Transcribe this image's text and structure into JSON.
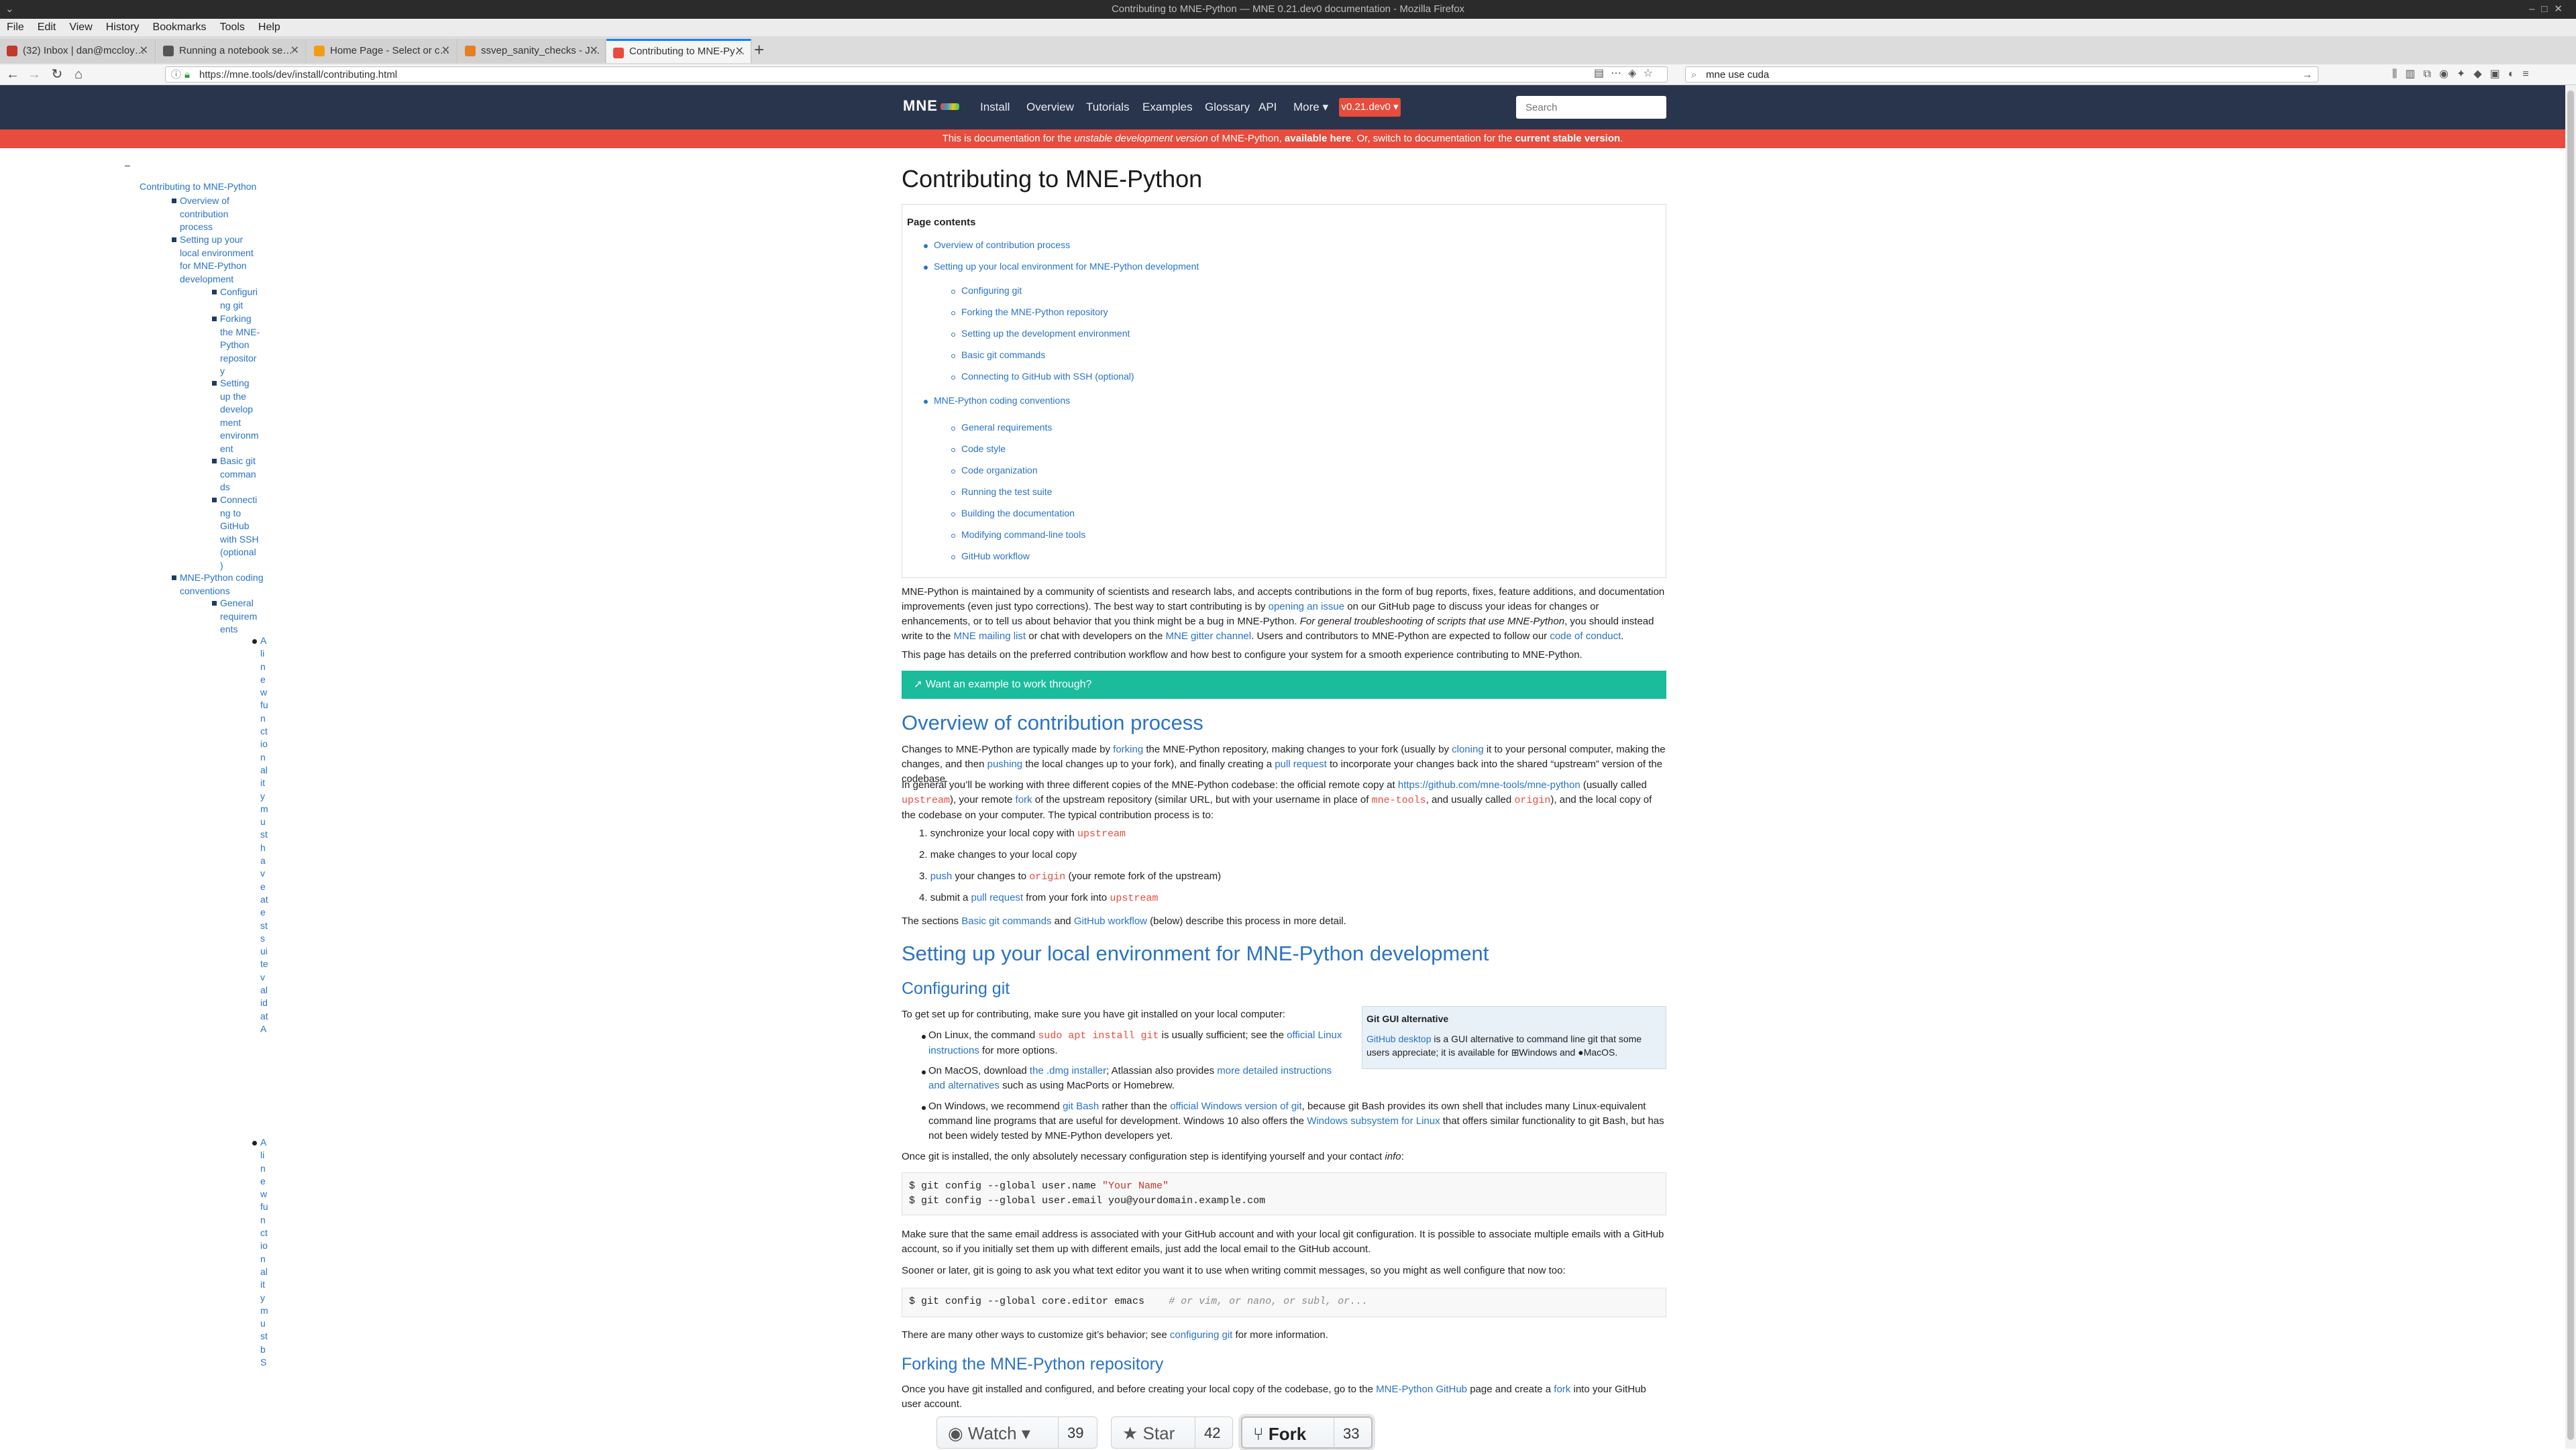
{
  "window": {
    "title": "Contributing to MNE-Python — MNE 0.21.dev0 documentation - Mozilla Firefox"
  },
  "menu": [
    "File",
    "Edit",
    "View",
    "History",
    "Bookmarks",
    "Tools",
    "Help"
  ],
  "tabs": [
    {
      "label": "(32) Inbox | dan@mccloy…",
      "color": "#c0392b"
    },
    {
      "label": "Running a notebook se…",
      "color": "#555555"
    },
    {
      "label": "Home Page - Select or c…",
      "color": "#f39c12"
    },
    {
      "label": "ssvep_sanity_checks - J…",
      "color": "#e67e22"
    },
    {
      "label": "Contributing to MNE-Py…",
      "color": "#e74c3c"
    }
  ],
  "toolbar": {
    "url": "https://mne.tools/dev/install/contributing.html",
    "search_value": "mne use cuda"
  },
  "site": {
    "logo": "MNE",
    "nav": [
      "Install",
      "Overview",
      "Tutorials",
      "Examples",
      "Glossary",
      "API",
      "More ▾"
    ],
    "version": "v0.21.dev0 ▾",
    "search_placeholder": "Search"
  },
  "banner": {
    "pre": "This is documentation for the ",
    "em": "unstable development version",
    "mid": " of MNE-Python, ",
    "link1": "available here",
    "mid2": ". Or, switch to documentation for the ",
    "link2": "current stable version",
    "end": "."
  },
  "sidebar": {
    "dash": "–",
    "l1": [
      "Contributing to MNE-Python"
    ],
    "l2a": [
      "Overview of",
      "contribution",
      "process"
    ],
    "l2b": [
      "Setting up your",
      "local environment",
      "for MNE-Python",
      "development"
    ],
    "l3a": [
      "Configuri",
      "ng git"
    ],
    "l3b": [
      "Forking",
      "the MNE-",
      "Python",
      "repositor",
      "y"
    ],
    "l3c": [
      "Setting",
      "up the",
      "develop",
      "ment",
      "environm",
      "ent"
    ],
    "l3d": [
      "Basic git",
      "comman",
      "ds"
    ],
    "l3e": [
      "Connecti",
      "ng to",
      "GitHub",
      "with SSH",
      "(optional",
      ")"
    ],
    "l2c": [
      "MNE-Python coding",
      "conventions"
    ],
    "l3f": [
      "General",
      "requirem",
      "ents"
    ],
    "vcol1": "AlinewfunctionalitymusthaveatestsuitevalidatA",
    "vcol2": "AlinewfunctionalitymustbS"
  },
  "page": {
    "title": "Contributing to MNE-Python",
    "toc_title": "Page contents",
    "toc": {
      "s1": "Overview of contribution process",
      "s2": "Setting up your local environment for MNE-Python development",
      "s2_sub": [
        "Configuring git",
        "Forking the MNE-Python repository",
        "Setting up the development environment",
        "Basic git commands",
        "Connecting to GitHub with SSH (optional)"
      ],
      "s3": "MNE-Python coding conventions",
      "s3_sub": [
        "General requirements",
        "Code style",
        "Code organization",
        "Running the test suite",
        "Building the documentation",
        "Modifying command-line tools",
        "GitHub workflow"
      ]
    },
    "intro": {
      "t1": "MNE-Python is maintained by a community of scientists and research labs, and accepts contributions in the form of bug reports, fixes, feature additions, and documentation improvements (even just typo corrections). The best way to start contributing is by ",
      "a1": "opening an issue",
      "t2": " on our GitHub page to discuss your ideas for changes or enhancements, or to tell us about behavior that you think might be a bug in MNE-Python. ",
      "em": "For general troubleshooting of scripts that use MNE-Python",
      "t3": ", you should instead write to the ",
      "a2": "MNE mailing list",
      "t4": " or chat with developers on the ",
      "a3": "MNE gitter channel",
      "t5": ". Users and contributors to MNE-Python are expected to follow our ",
      "a4": "code of conduct",
      "t6": "."
    },
    "intro2": "This page has details on the preferred contribution workflow and how best to configure your system for a smooth experience contributing to MNE-Python.",
    "example_btn": "Want an example to work through?",
    "h_overview": "Overview of contribution process",
    "ov1": {
      "t1": "Changes to MNE-Python are typically made by ",
      "a1": "forking",
      "t2": " the MNE-Python repository, making changes to your fork (usually by ",
      "a2": "cloning",
      "t3": " it to your personal computer, making the changes, and then ",
      "a3": "pushing",
      "t4": " the local changes up to your fork), and finally creating a ",
      "a4": "pull request",
      "t5": " to incorporate your changes back into the shared “upstream” version of the codebase."
    },
    "ov2": {
      "t1": "In general you’ll be working with three different copies of the MNE-Python codebase: the official remote copy at ",
      "a1": "https://github.com/mne-tools/mne-python",
      "t2": " (usually called ",
      "c1": "upstream",
      "t3": "), your remote ",
      "a2": "fork",
      "t4": " of the upstream repository (similar URL, but with your username in place of ",
      "c2": "mne-tools",
      "t5": ", and usually called ",
      "c3": "origin",
      "t6": "), and the local copy of the codebase on your computer. The typical contribution process is to:"
    },
    "steps": {
      "s1a": "synchronize your local copy with ",
      "s1c": "upstream",
      "s2": "make changes to your local copy",
      "s3a": "push",
      "s3b": " your changes to ",
      "s3c": "origin",
      "s3d": " (your remote fork of the upstream)",
      "s4a": "submit a ",
      "s4b": "pull request",
      "s4c": " from your fork into ",
      "s4d": "upstream"
    },
    "sections": {
      "t1": "The sections ",
      "a1": "Basic git commands",
      "t2": " and ",
      "a2": "GitHub workflow",
      "t3": " (below) describe this process in more detail."
    },
    "h_setup": "Setting up your local environment for MNE-Python development",
    "h_config": "Configuring git",
    "cfg1": "To get set up for contributing, make sure you have git installed on your local computer:",
    "linux": {
      "t1": "On Linux, the command ",
      "c": "sudo apt install git",
      "t2": " is usually sufficient; see the ",
      "a": "official Linux instructions",
      "t3": " for more options."
    },
    "mac": {
      "t1": "On MacOS, download ",
      "a1": "the .dmg installer",
      "t2": "; Atlassian also provides ",
      "a2": "more detailed instructions and alternatives",
      "t3": " such as using MacPorts or Homebrew."
    },
    "win": {
      "t1": "On Windows, we recommend ",
      "a1": "git Bash",
      "t2": " rather than the ",
      "a2": "official Windows version of git",
      "t3": ", because git Bash provides its own shell that includes many Linux-equivalent command line programs that are useful for development. Windows 10 also offers the ",
      "a3": "Windows subsystem for Linux",
      "t4": " that offers similar functionality to git Bash, but has not been widely tested by MNE-Python developers yet."
    },
    "gitgui": {
      "title": "Git GUI alternative",
      "a": "GitHub desktop",
      "t": " is a GUI alternative to command line git that some users appreciate; it is available for ",
      "win": "Windows",
      "and": " and ",
      "mac": "MacOS",
      "end": "."
    },
    "once": {
      "t1": "Once git is installed, the only absolutely necessary configuration step is identifying yourself and your contact ",
      "em": "info",
      "t2": ":"
    },
    "code1": {
      "l1a": "$ git config --global user.name ",
      "l1b": "\"Your Name\"",
      "l2": "$ git config --global user.email you@yourdomain.example.com"
    },
    "same_email": "Make sure that the same email address is associated with your GitHub account and with your local git configuration. It is possible to associate multiple emails with a GitHub account, so if you initially set them up with different emails, just add the local email to the GitHub account.",
    "editor": "Sooner or later, git is going to ask you what text editor you want it to use when writing commit messages, so you might as well configure that now too:",
    "code2": {
      "cmd": "$ git config --global core.editor emacs    ",
      "cmt": "# or vim, or nano, or subl, or..."
    },
    "other": {
      "t1": "There are many other ways to customize git’s behavior; see ",
      "a": "configuring git",
      "t2": " for more information."
    },
    "h_fork": "Forking the MNE-Python repository",
    "fork1": {
      "t1": "Once you have git installed and configured, and before creating your local copy of the codebase, go to the ",
      "a1": "MNE-Python GitHub",
      "t2": " page and create a ",
      "a2": "fork",
      "t3": " into your GitHub user account."
    },
    "gh": {
      "watch": "Watch ▾",
      "watch_n": "39",
      "star": "Star",
      "star_n": "42",
      "fork": "Fork",
      "fork_n": "33"
    }
  }
}
